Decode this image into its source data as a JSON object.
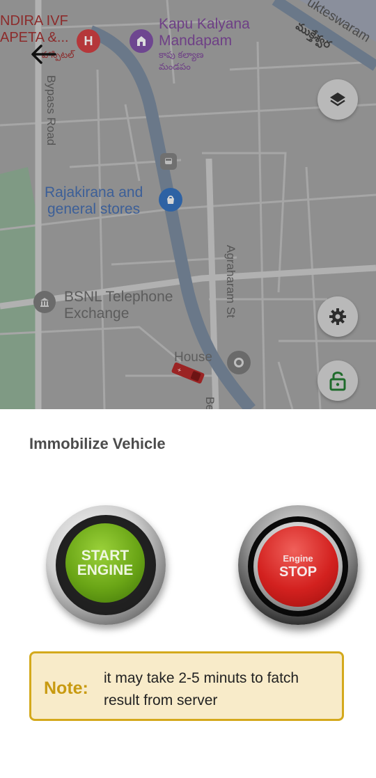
{
  "map": {
    "labels": {
      "hospital_top": "NDIRA IVF",
      "hospital_bottom": "APETA &...",
      "hospital_telugu": "హాస్పిటల్",
      "mandapam_line1": "Kapu Kalyana",
      "mandapam_line2": "Mandapam",
      "mandapam_telugu1": "కాపు కల్యాణ",
      "mandapam_telugu2": "మండపం",
      "road_top_right": "ukteswaram",
      "road_top_right_telugu": "ముక్తేశ్వర",
      "bypass_road": "Bypass Road",
      "store_line1": "Rajakirana and",
      "store_line2": "general stores",
      "agraharam": "Agraharam St",
      "bsnl_line1": "BSNL Telephone",
      "bsnl_line2": "Exchange",
      "house": "House",
      "bottom_street": "Be"
    },
    "icons": [
      "hospital-pin-icon",
      "temple-pin-icon",
      "bus-stop-icon",
      "store-pin-icon",
      "bank-pin-icon",
      "place-pin-icon",
      "vehicle-marker-icon"
    ],
    "controls": [
      "back-arrow-icon",
      "layers-icon",
      "gear-icon",
      "unlock-icon"
    ]
  },
  "panel": {
    "title": "Immobilize Vehicle",
    "start_button": {
      "line1": "START",
      "line2": "ENGINE"
    },
    "stop_button": {
      "small": "Engine",
      "big": "STOP"
    },
    "note": {
      "label": "Note:",
      "text": "it may take 2-5 minuts to fatch result from server"
    }
  },
  "colors": {
    "note_border": "#d4a91c",
    "note_bg": "#f8ebc9",
    "note_label": "#c89a10",
    "start_green": "#6aa516",
    "stop_red": "#d3211f",
    "unlock_green": "#1f6b2b"
  }
}
